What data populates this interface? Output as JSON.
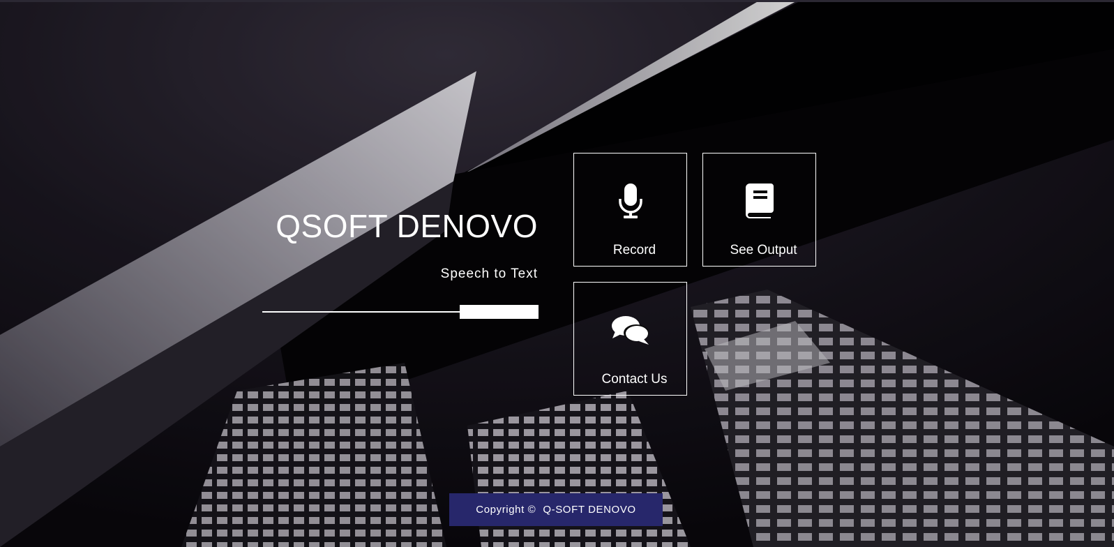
{
  "brand": {
    "title": "QSOFT DENOVO",
    "subtitle": "Speech to Text"
  },
  "tiles": [
    {
      "label": "Record",
      "icon": "microphone-icon"
    },
    {
      "label": "See Output",
      "icon": "book-icon"
    },
    {
      "label": "Contact Us",
      "icon": "comments-icon"
    }
  ],
  "footer": {
    "copyright_label": "Copyright ©",
    "company": "Q-SOFT DENOVO"
  },
  "colors": {
    "footer_bg": "#27276b",
    "text": "#ffffff",
    "background": "#0e0b12"
  }
}
